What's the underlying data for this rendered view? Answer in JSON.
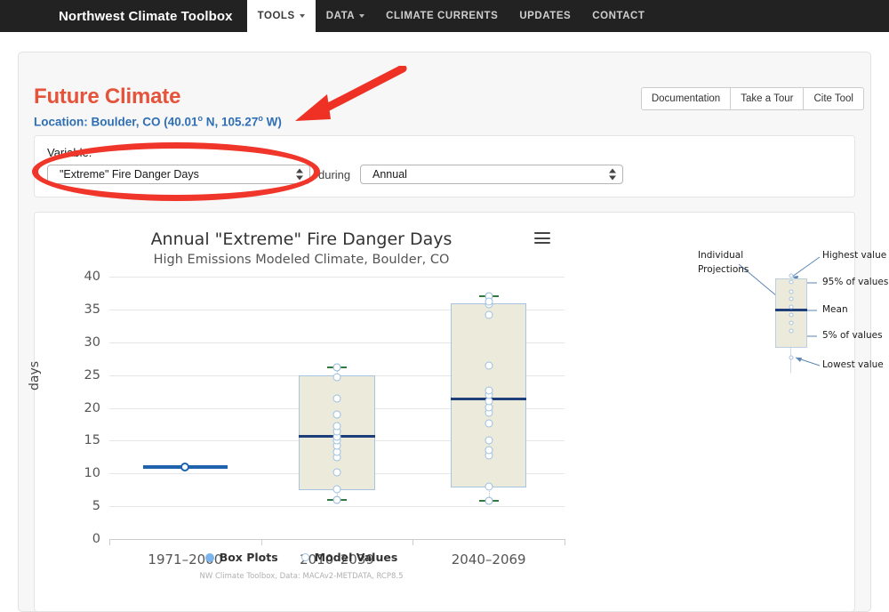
{
  "navbar": {
    "brand": "Northwest Climate Toolbox",
    "items": [
      {
        "label": "TOOLS",
        "caret": true,
        "active": true
      },
      {
        "label": "DATA",
        "caret": true,
        "active": false
      },
      {
        "label": "CLIMATE CURRENTS",
        "caret": false,
        "active": false
      },
      {
        "label": "UPDATES",
        "caret": false,
        "active": false
      },
      {
        "label": "CONTACT",
        "caret": false,
        "active": false
      }
    ]
  },
  "header": {
    "title": "Future Climate",
    "location_prefix": "Location: Boulder, CO (40.01",
    "location_mid": " N, 105.27",
    "location_suffix": " W)",
    "degree": "o",
    "buttons": [
      "Documentation",
      "Take a Tour",
      "Cite Tool"
    ]
  },
  "controls": {
    "variable_label": "Variable:",
    "variable_value": "\"Extreme\" Fire Danger Days",
    "during_label": "during",
    "time_value": "Annual"
  },
  "chart_data": {
    "type": "box",
    "title": "Annual \"Extreme\" Fire Danger Days",
    "subtitle": "High Emissions Modeled Climate, Boulder, CO",
    "ylabel": "days",
    "xlabel": "",
    "ylim": [
      0,
      40
    ],
    "yticks": [
      0,
      5,
      10,
      15,
      20,
      25,
      30,
      35,
      40
    ],
    "grid": true,
    "categories": [
      "1971–2000",
      "2010–2039",
      "2040–2069"
    ],
    "legend": [
      {
        "label": "Box Plots",
        "marker": "filled"
      },
      {
        "label": "Model Values",
        "marker": "open"
      }
    ],
    "legend_position": "bottom",
    "credit": "NW Climate Toolbox, Data: MACAv2-METDATA, RCP8.5",
    "menu_icon": "hamburger-icon",
    "series": [
      {
        "name": "1971–2000",
        "kind": "historical-line",
        "value": 11.0
      },
      {
        "name": "2010–2039",
        "kind": "box",
        "lowest": 5.9,
        "pct5": 7.5,
        "mean": 15.6,
        "pct95": 25.0,
        "highest": 26.2,
        "model_values": [
          7.6,
          10.2,
          12.5,
          13.3,
          14.2,
          15.0,
          15.6,
          16.4,
          17.2,
          19.0,
          21.4,
          24.7
        ]
      },
      {
        "name": "2040–2069",
        "kind": "box",
        "lowest": 5.8,
        "pct5": 7.9,
        "mean": 21.3,
        "pct95": 36.0,
        "highest": 37.0,
        "model_values": [
          8.0,
          12.8,
          13.6,
          15.1,
          17.6,
          19.2,
          20.1,
          21.0,
          21.9,
          22.6,
          26.5,
          34.2,
          35.8,
          36.2
        ]
      }
    ]
  },
  "diagram": {
    "labels": {
      "individual": "Individual",
      "projections": "Projections",
      "highest": "Highest value",
      "pct95": "95% of values",
      "mean": "Mean",
      "pct5": "5% of values",
      "lowest": "Lowest value"
    }
  },
  "annotations": {
    "ellipse_color": "#f0362a",
    "arrow_color": "#ee3124"
  }
}
